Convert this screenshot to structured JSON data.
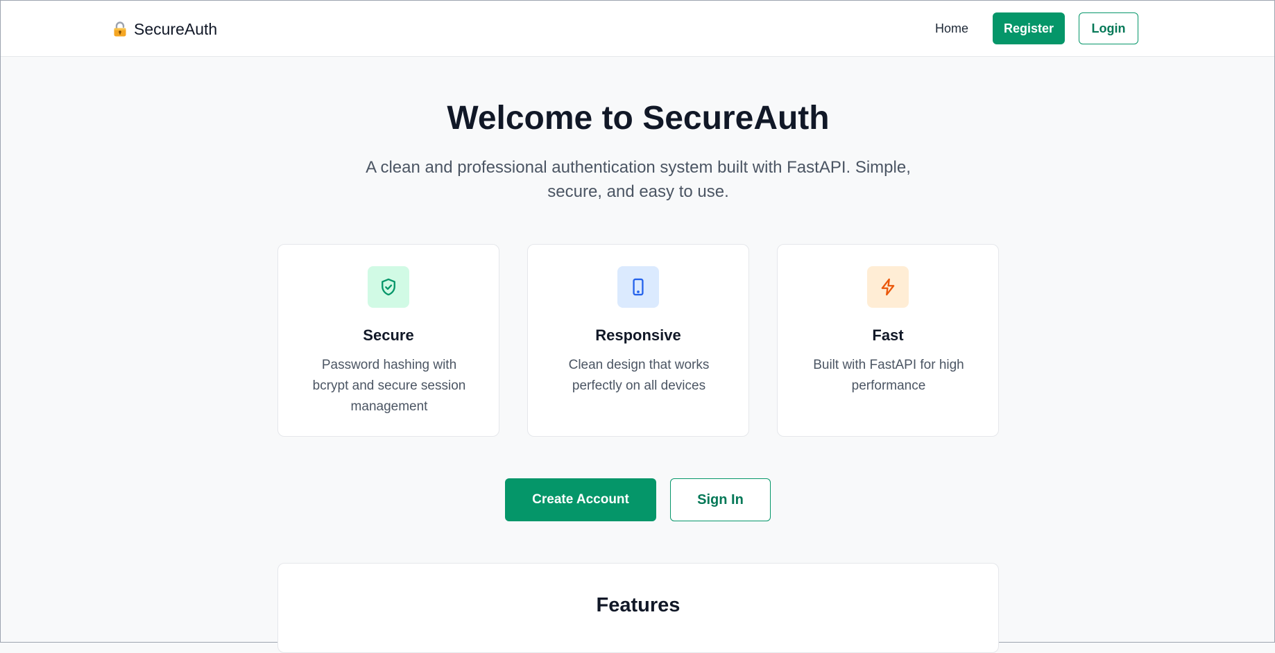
{
  "header": {
    "brand_name": "SecureAuth",
    "brand_icon": "lock-icon",
    "nav": {
      "home": "Home",
      "register": "Register",
      "login": "Login"
    }
  },
  "hero": {
    "title": "Welcome to SecureAuth",
    "subtitle": "A clean and professional authentication system built with FastAPI. Simple, secure, and easy to use."
  },
  "cards": [
    {
      "icon": "shield-check-icon",
      "icon_bg": "#d1fae5",
      "icon_color": "#059669",
      "title": "Secure",
      "description": "Password hashing with bcrypt and secure session management"
    },
    {
      "icon": "tablet-icon",
      "icon_bg": "#dbeafe",
      "icon_color": "#2563eb",
      "title": "Responsive",
      "description": "Clean design that works perfectly on all devices"
    },
    {
      "icon": "lightning-icon",
      "icon_bg": "#ffedd5",
      "icon_color": "#ea580c",
      "title": "Fast",
      "description": "Built with FastAPI for high performance"
    }
  ],
  "cta": {
    "create_account": "Create Account",
    "sign_in": "Sign In"
  },
  "features_section": {
    "title": "Features"
  },
  "colors": {
    "primary": "#059669",
    "background": "#f8f9fa",
    "text": "#111827",
    "muted_text": "#4b5563"
  }
}
